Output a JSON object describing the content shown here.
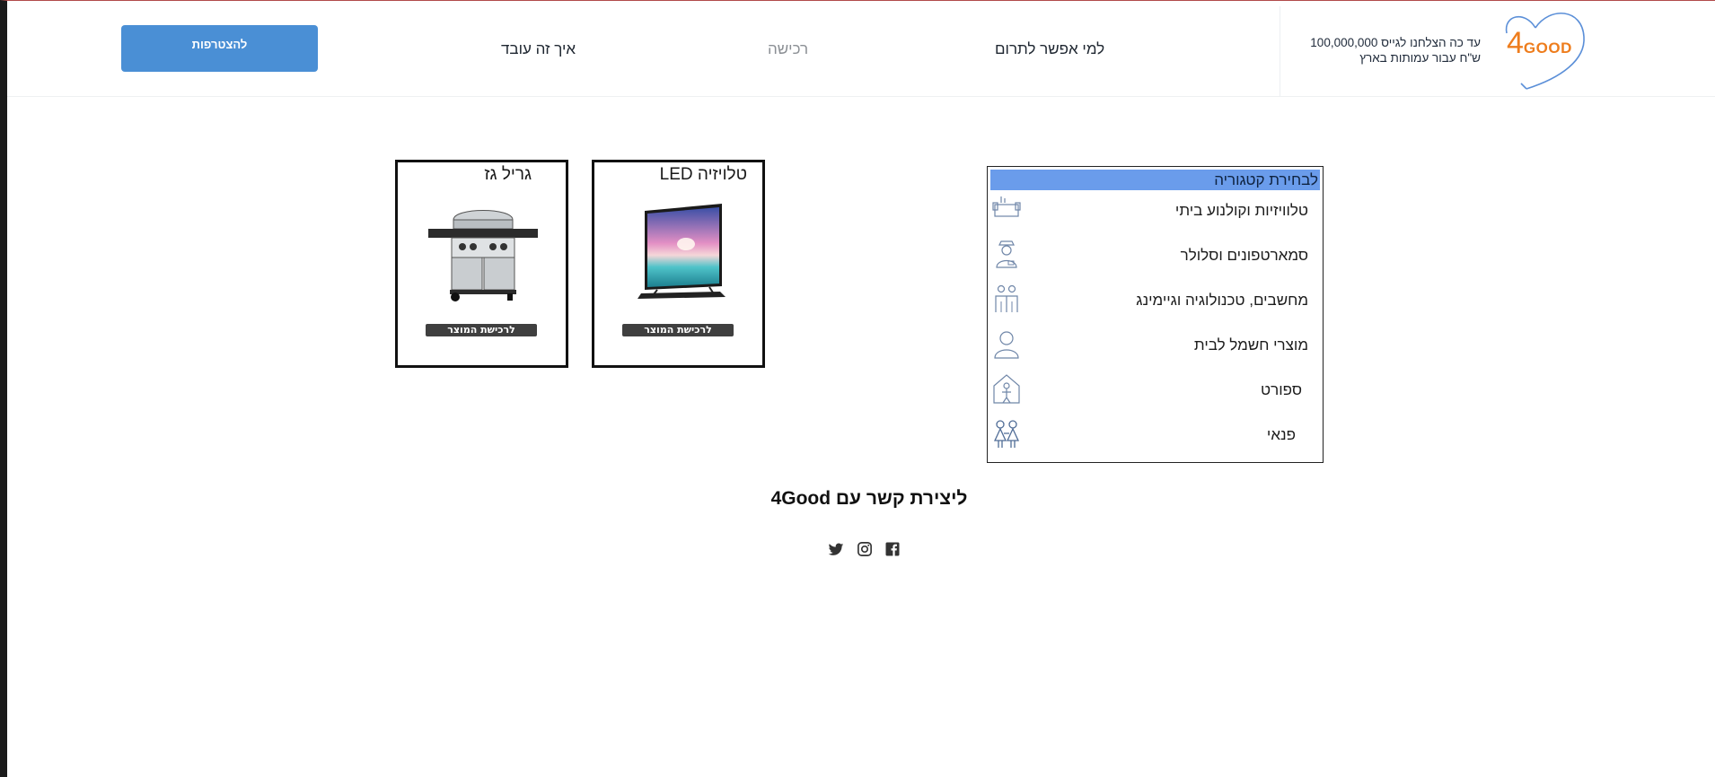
{
  "header": {
    "logo": {
      "four": "4",
      "good": "GOOD"
    },
    "tagline": "עד כה הצלחנו לגייס 100,000,000 ש\"ח עבור עמותות בארץ",
    "nav": {
      "who_to_donate": "למי אפשר לתרום",
      "purchase": "רכישה",
      "how_it_works": "איך זה עובד"
    },
    "join_label": "להצטרפות"
  },
  "categories": {
    "header": "לבחירת קטגוריה",
    "items": [
      {
        "label": "טלוויזיות וקולנוע ביתי",
        "icon": "tv-sofa-icon"
      },
      {
        "label": "סמארטפונים וסלולר",
        "icon": "person-cap-icon"
      },
      {
        "label": "מחשבים, טכנולוגיה וגיימינג",
        "icon": "people-icon"
      },
      {
        "label": "מוצרי חשמל לבית",
        "icon": "person-icon"
      },
      {
        "label": "ספורט",
        "icon": "house-person-icon"
      },
      {
        "label": "פנאי",
        "icon": "children-icon"
      }
    ]
  },
  "products": [
    {
      "title": "טלויזיה LED",
      "button": "לרכישת המוצר",
      "image": "tv-image"
    },
    {
      "title": "גריל גז",
      "button": "לרכישת המוצר",
      "image": "gas-grill-image"
    }
  ],
  "footer": {
    "contact_title": "ליצירת קשר עם 4Good",
    "social": [
      "twitter-icon",
      "instagram-icon",
      "facebook-icon"
    ]
  },
  "colors": {
    "accent_button": "#4a8fd5",
    "category_header": "#6a9ceb",
    "logo_orange": "#ee7d1d",
    "logo_heart": "#5b8fd8",
    "buy_button": "#3f3f3f"
  }
}
